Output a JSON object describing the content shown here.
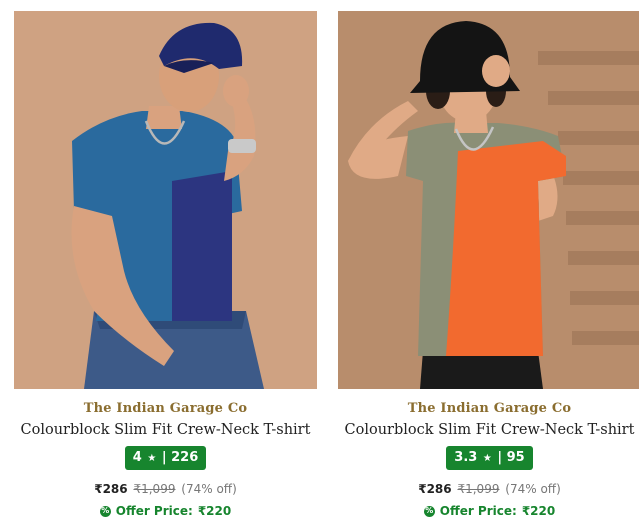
{
  "products": [
    {
      "brand": "The Indian Garage Co",
      "title": "Colourblock Slim Fit Crew-Neck T-shirt",
      "rating": "4",
      "rating_star": "★",
      "rating_sep": "|",
      "reviews": "226",
      "price": "₹286",
      "mrp": "₹1,099",
      "discount": "(74% off)",
      "offer_label": "Offer Price:",
      "offer_price": "₹220",
      "image_desc": "model in blue and navy colourblock t-shirt with navy cap"
    },
    {
      "brand": "The Indian Garage Co",
      "title": "Colourblock Slim Fit Crew-Neck T-shirt",
      "rating": "3.3",
      "rating_star": "★",
      "rating_sep": "|",
      "reviews": "95",
      "price": "₹286",
      "mrp": "₹1,099",
      "discount": "(74% off)",
      "offer_label": "Offer Price:",
      "offer_price": "₹220",
      "image_desc": "model in olive and orange colourblock t-shirt with black bucket hat"
    }
  ],
  "colors": {
    "brand": "#8a6d2f",
    "rating_bg": "#17852e",
    "offer": "#17852e",
    "bg_left": "#c99a78",
    "bg_right": "#b58a6a"
  }
}
